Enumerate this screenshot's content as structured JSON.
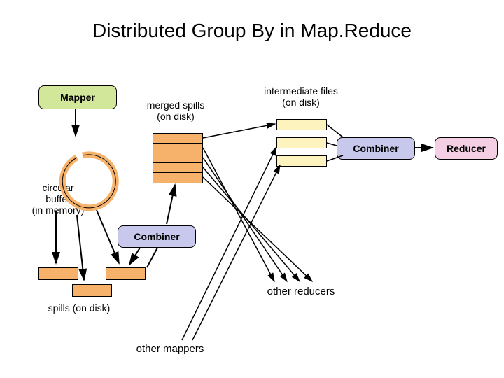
{
  "title": "Distributed Group By in Map.Reduce",
  "mapper_label": "Mapper",
  "circular_buffer_label": "circular\nbuffer\n(in memory)",
  "spills_label": "spills (on disk)",
  "merged_spills_label": "merged spills\n(on disk)",
  "combiner1_label": "Combiner",
  "intermediate_label": "intermediate files\n(on disk)",
  "combiner2_label": "Combiner",
  "reducer_label": "Reducer",
  "other_reducers_label": "other reducers",
  "other_mappers_label": "other mappers",
  "colors": {
    "mapper_fill": "#d3e79b",
    "combiner_fill": "#c7c8ec",
    "reducer_fill": "#f4cfe4",
    "orange_fill": "#f6b26b",
    "yellow_fill": "#fdf3bf"
  }
}
